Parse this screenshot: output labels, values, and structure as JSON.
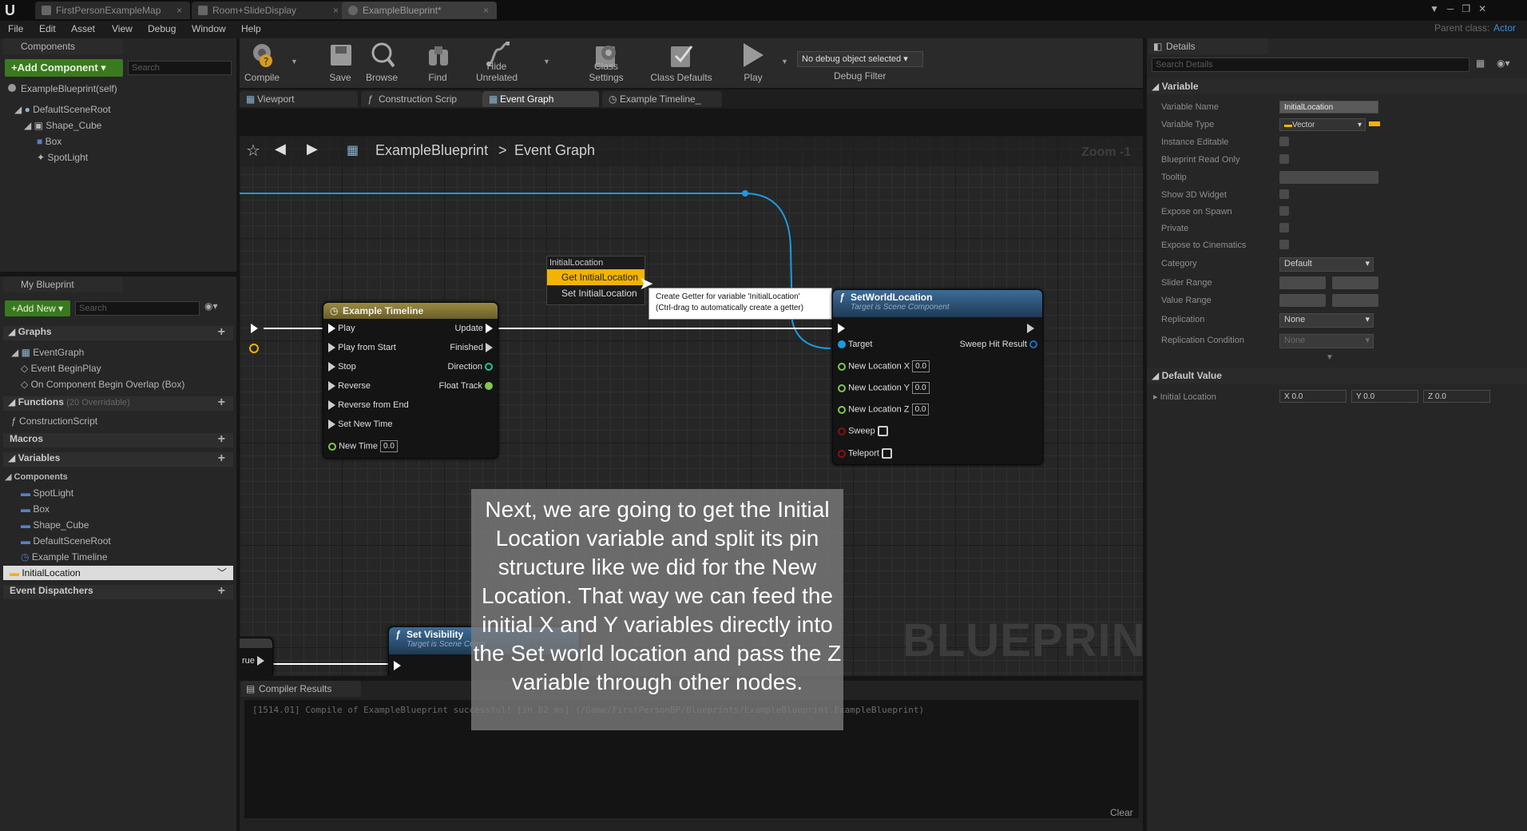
{
  "app": {
    "doc_tabs": [
      "FirstPersonExampleMap",
      "Room+SlideDisplay",
      "ExampleBlueprint*"
    ],
    "menu": [
      "File",
      "Edit",
      "Asset",
      "View",
      "Debug",
      "Window",
      "Help"
    ],
    "parent_class_label": "Parent class:",
    "parent_class_value": "Actor"
  },
  "components": {
    "tab": "Components",
    "add_button": "+Add Component ▾",
    "search_placeholder": "Search",
    "self": "ExampleBlueprint(self)",
    "tree": [
      "DefaultSceneRoot",
      "Shape_Cube",
      "Box",
      "SpotLight"
    ]
  },
  "my_blueprint": {
    "tab": "My Blueprint",
    "add_button": "+Add New ▾",
    "search_placeholder": "Search",
    "graphs_header": "Graphs",
    "event_graph": "EventGraph",
    "events": [
      "Event BeginPlay",
      "On Component Begin Overlap (Box)"
    ],
    "functions_header": "Functions",
    "functions_count": "(20 Overridable)",
    "construction": "ConstructionScript",
    "macros_header": "Macros",
    "variables_header": "Variables",
    "components_header": "Components",
    "component_vars": [
      "SpotLight",
      "Box",
      "Shape_Cube",
      "DefaultSceneRoot",
      "Example Timeline"
    ],
    "selected_var": "InitialLocation",
    "dispatchers_header": "Event Dispatchers"
  },
  "toolbar": {
    "buttons": [
      "Compile",
      "Save",
      "Browse",
      "Find",
      "Hide Unrelated",
      "Class Settings",
      "Class Defaults",
      "Play"
    ],
    "debug_select": "No debug object selected ▾",
    "debug_filter": "Debug Filter"
  },
  "editor_tabs": [
    "Viewport",
    "Construction Scrip",
    "Event Graph",
    "Example Timeline_"
  ],
  "breadcrumb": {
    "root": "ExampleBlueprint",
    "sep": ">",
    "leaf": "Event Graph",
    "zoom": "Zoom -1"
  },
  "graph": {
    "watermark": "BLUEPRINT",
    "popup_title": "InitialLocation",
    "popup_items": [
      "Get InitialLocation",
      "Set InitialLocation"
    ],
    "tooltip": [
      "Create Getter for variable 'InitialLocation'",
      "(Ctrl-drag to automatically create a getter)"
    ],
    "timeline_node": {
      "title": "Example Timeline",
      "inputs": [
        "Play",
        "Play from Start",
        "Stop",
        "Reverse",
        "Reverse from End",
        "Set New Time"
      ],
      "new_time_label": "New Time",
      "new_time_value": "0.0",
      "outputs": [
        "Update",
        "Finished",
        "Direction",
        "Float Track"
      ]
    },
    "set_world_node": {
      "title": "SetWorldLocation",
      "subtitle": "Target is Scene Component",
      "target": "Target",
      "sweep_result": "Sweep Hit Result",
      "loc_pins": [
        "New Location X",
        "New Location Y",
        "New Location Z"
      ],
      "loc_values": [
        "0.0",
        "0.0",
        "0.0"
      ],
      "sweep": "Sweep",
      "teleport": "Teleport"
    },
    "set_vis_node": {
      "title": "Set Visibility",
      "subtitle": "Target is Scene Comp"
    },
    "true_label": "rue"
  },
  "compiler": {
    "tab": "Compiler Results",
    "log": "[1514.01] Compile of ExampleBlueprint successful! [in 82 ms] (/Game/FirstPersonBP/Blueprints/ExampleBlueprint.ExampleBlueprint)",
    "clear": "Clear"
  },
  "details": {
    "tab": "Details",
    "search_placeholder": "Search Details",
    "variable_header": "Variable",
    "rows": [
      "Variable Name",
      "Variable Type",
      "Instance Editable",
      "Blueprint Read Only",
      "Tooltip",
      "Show 3D Widget",
      "Expose on Spawn",
      "Private",
      "Expose to Cinematics",
      "Category",
      "Slider Range",
      "Value Range",
      "Replication",
      "Replication Condition"
    ],
    "variable_name": "InitialLocation",
    "variable_type": "Vector",
    "category": "Default",
    "replication": "None",
    "replication_condition": "None",
    "default_header": "Default Value",
    "initial_location_label": "Initial Location",
    "xyz": [
      "X 0.0",
      "Y 0.0",
      "Z 0.0"
    ]
  },
  "caption": "Next, we are going to get the Initial Location variable and split its pin structure like we did for the New Location. That way we can feed the initial X and Y variables directly into the Set world location and pass the Z variable through other nodes.",
  "colors": {
    "accent_green": "#3a7a1f",
    "exec_wire": "#ffffff",
    "object_wire": "#1a9be0",
    "vector_yellow": "#f3b300",
    "timeline_header": "#8a7a3a",
    "function_header": "#2e5c86"
  }
}
